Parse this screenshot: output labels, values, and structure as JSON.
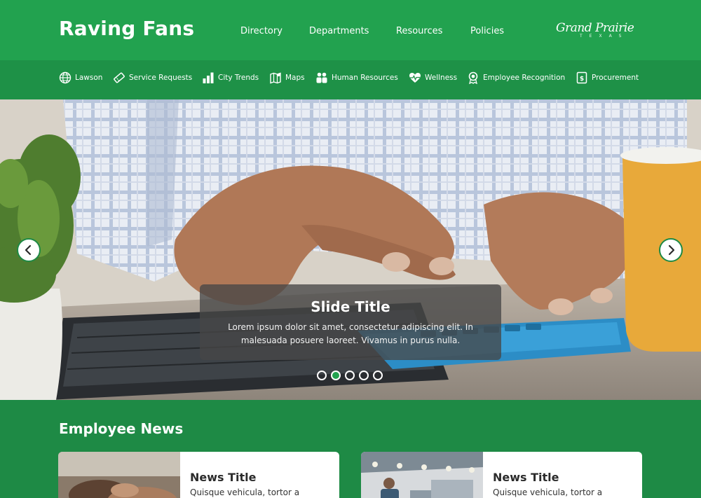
{
  "header": {
    "brand": "Raving Fans",
    "nav": [
      "Directory",
      "Departments",
      "Resources",
      "Policies"
    ],
    "city_logo_text": "Grand Prairie",
    "city_logo_sub": "TEXAS"
  },
  "quick_links": [
    {
      "label": "Lawson",
      "icon": "globe-icon"
    },
    {
      "label": "Service Requests",
      "icon": "ticket-icon"
    },
    {
      "label": "City Trends",
      "icon": "bar-chart-icon"
    },
    {
      "label": "Maps",
      "icon": "map-icon"
    },
    {
      "label": "Human Resources",
      "icon": "people-icon"
    },
    {
      "label": "Wellness",
      "icon": "heartbeat-icon"
    },
    {
      "label": "Employee Recognition",
      "icon": "award-icon"
    },
    {
      "label": "Procurement",
      "icon": "document-icon"
    }
  ],
  "slider": {
    "title": "Slide Title",
    "text": "Lorem ipsum dolor sit amet, consectetur adipiscing elit. In malesuada posuere laoreet. Vivamus in purus nulla.",
    "slide_count": 5,
    "active_slide": 2
  },
  "news": {
    "heading": "Employee News",
    "cards": [
      {
        "title": "News Title",
        "excerpt": "Quisque vehicula, tortor a"
      },
      {
        "title": "News Title",
        "excerpt": "Quisque vehicula, tortor a"
      }
    ]
  },
  "colors": {
    "header_green": "#22a24f",
    "quickbar_green": "#1e9147",
    "section_green": "#1e8a45"
  }
}
